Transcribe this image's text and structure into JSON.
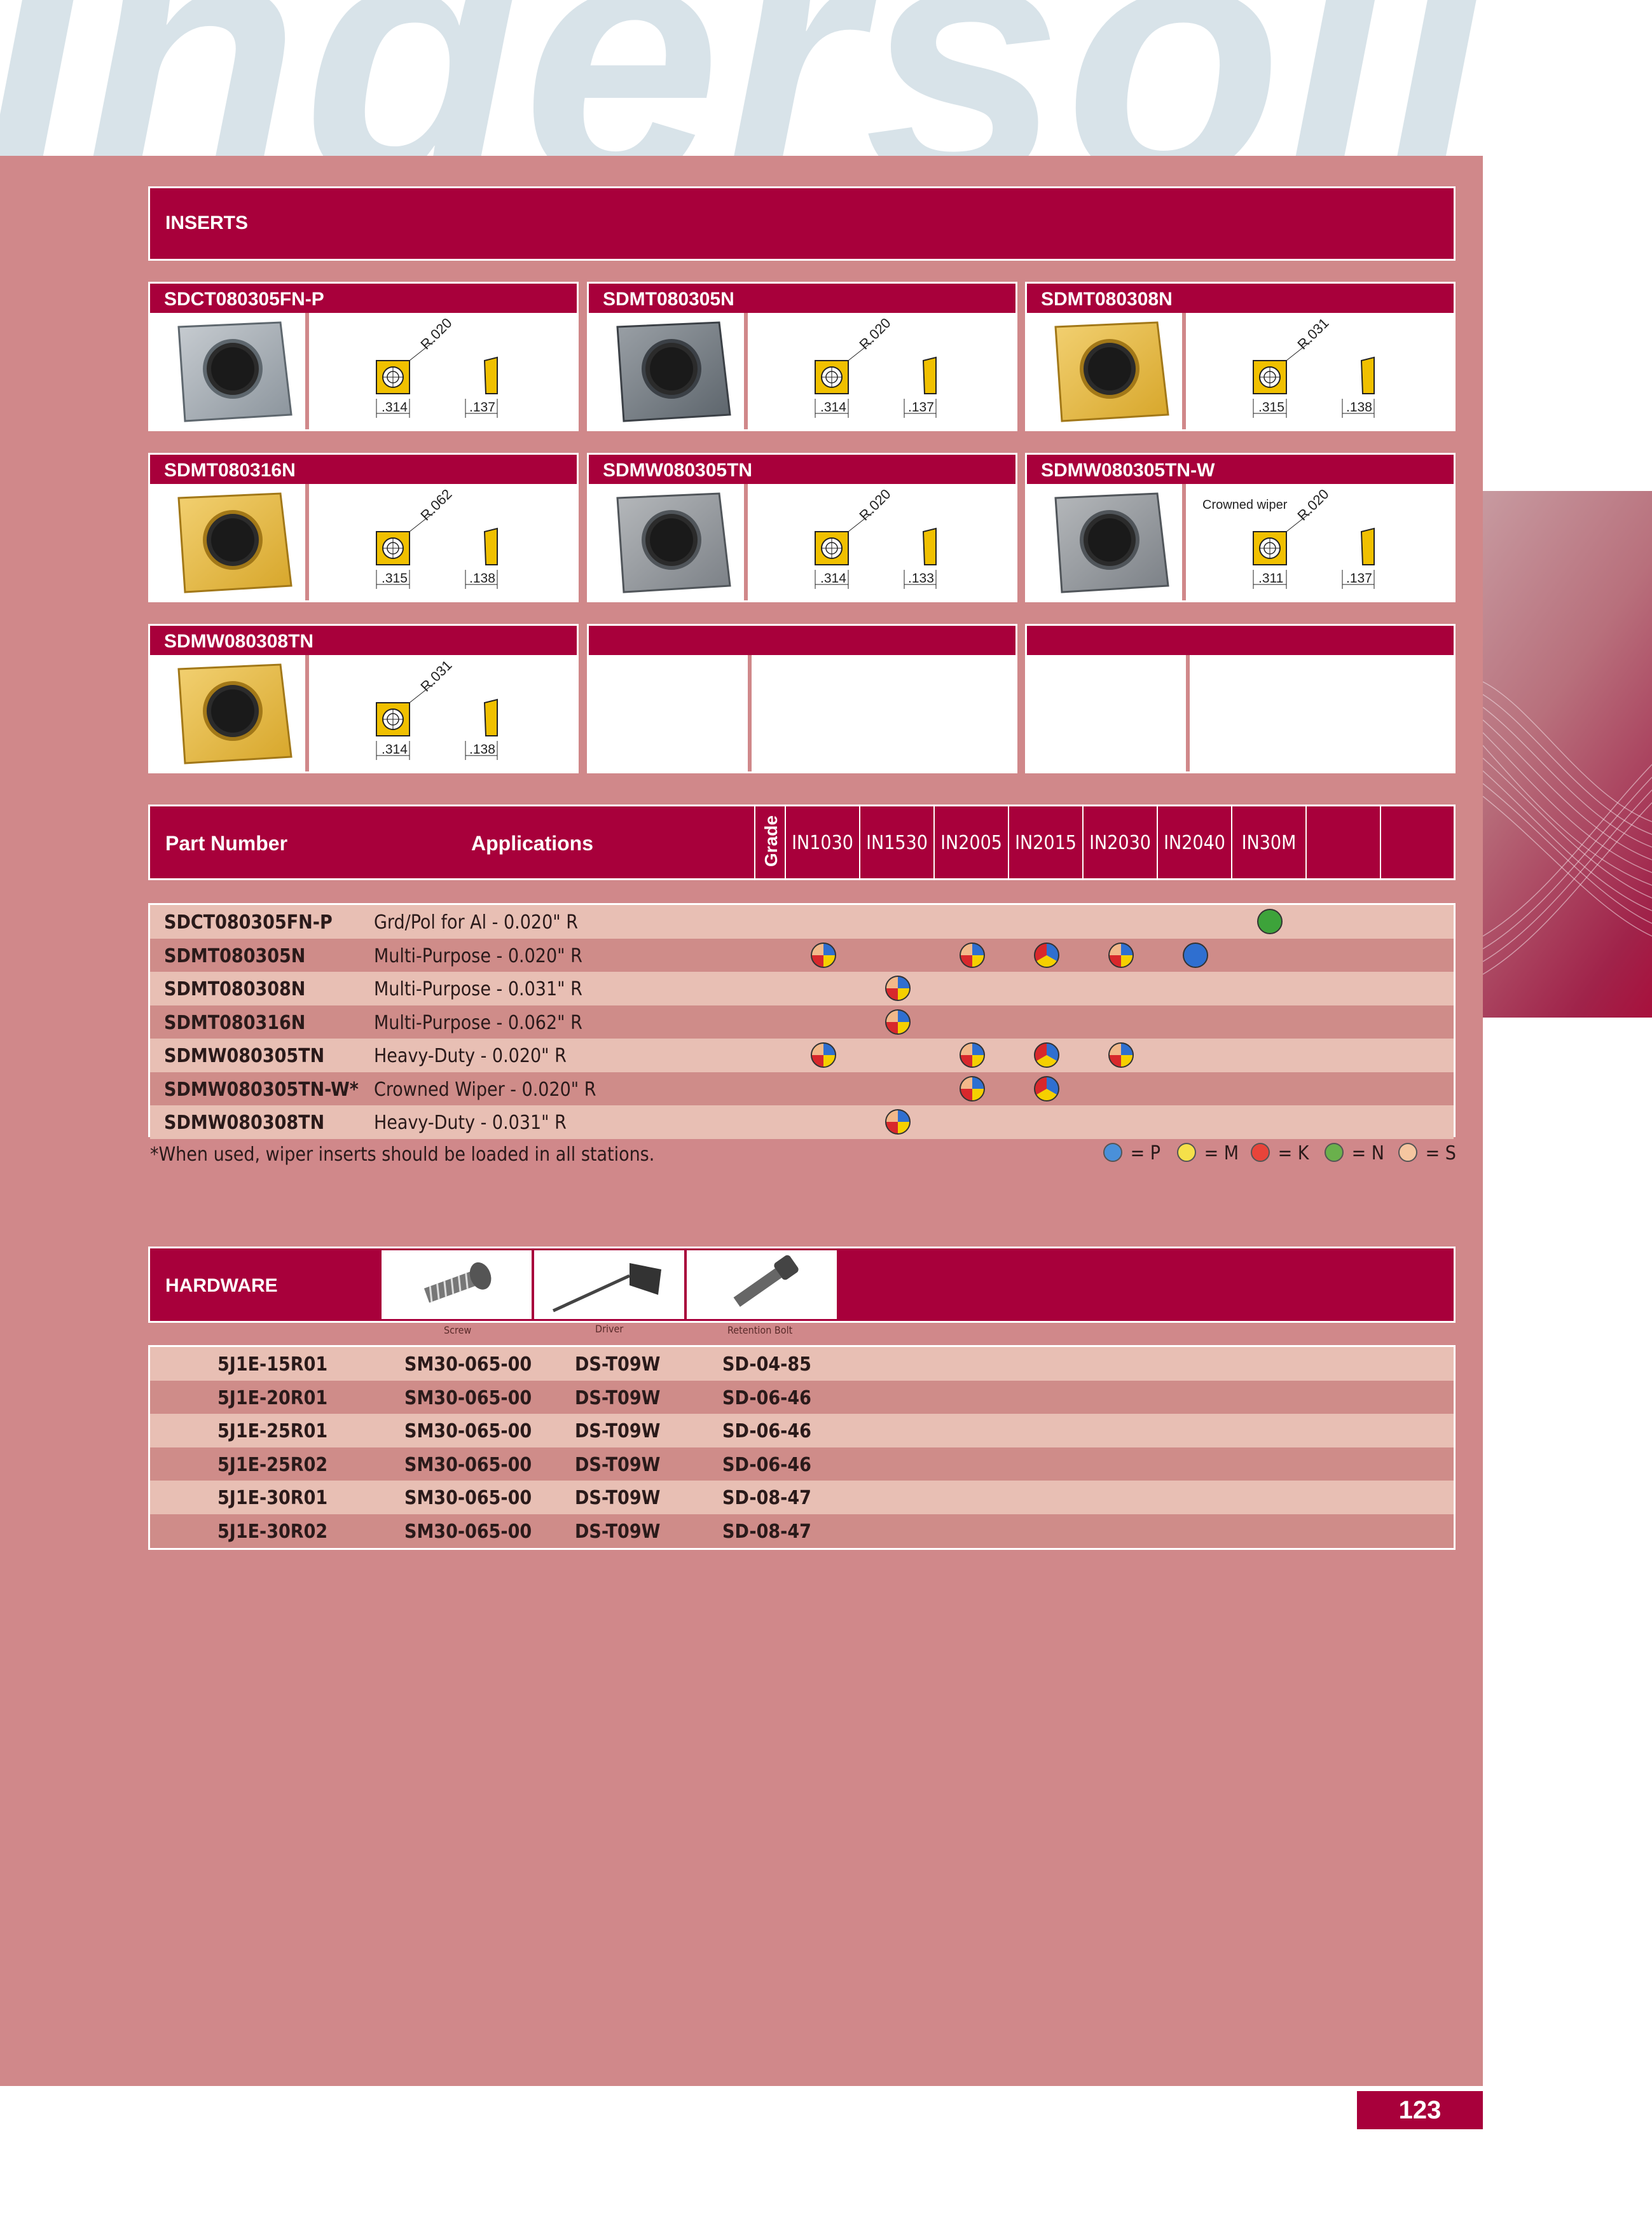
{
  "brand_watermark": "Ingersoll",
  "inserts_title": "INSERTS",
  "insert_cards": [
    {
      "name": "SDCT080305FN-P",
      "radius": "R.020",
      "width": ".314",
      "thick": ".137",
      "color": "silver"
    },
    {
      "name": "SDMT080305N",
      "radius": "R.020",
      "width": ".314",
      "thick": ".137",
      "color": "dark"
    },
    {
      "name": "SDMT080308N",
      "radius": "R.031",
      "width": ".315",
      "thick": ".138",
      "color": "gold"
    },
    {
      "name": "SDMT080316N",
      "radius": "R.062",
      "width": ".315",
      "thick": ".138",
      "color": "gold"
    },
    {
      "name": "SDMW080305TN",
      "radius": "R.020",
      "width": ".314",
      "thick": ".133",
      "color": "grey"
    },
    {
      "name": "SDMW080305TN-W",
      "radius": "R.020",
      "width": ".311",
      "thick": ".137",
      "color": "grey",
      "note": "Crowned wiper"
    },
    {
      "name": "SDMW080308TN",
      "radius": "R.031",
      "width": ".314",
      "thick": ".138",
      "color": "gold"
    }
  ],
  "grade_table": {
    "col_part": "Part Number",
    "col_app": "Applications",
    "col_grade": "Grade",
    "grades": [
      "IN1030",
      "IN1530",
      "IN2005",
      "IN2015",
      "IN2030",
      "IN2040",
      "IN30M",
      "",
      ""
    ],
    "rows": [
      {
        "part": "SDCT080305FN-P",
        "app": "Grd/Pol for Al - 0.020\" R",
        "marks": {
          "IN30M": "N"
        }
      },
      {
        "part": "SDMT080305N",
        "app": "Multi-Purpose - 0.020\" R",
        "marks": {
          "IN1030": "PMKS",
          "IN2005": "PMKS",
          "IN2015": "PMK",
          "IN2030": "PMKS",
          "IN2040": "P"
        }
      },
      {
        "part": "SDMT080308N",
        "app": "Multi-Purpose - 0.031\" R",
        "marks": {
          "IN1530": "PMKS"
        }
      },
      {
        "part": "SDMT080316N",
        "app": "Multi-Purpose - 0.062\" R",
        "marks": {
          "IN1530": "PMKS"
        }
      },
      {
        "part": "SDMW080305TN",
        "app": "Heavy-Duty - 0.020\" R",
        "marks": {
          "IN1030": "PMKS",
          "IN2005": "PMKS",
          "IN2015": "PMK",
          "IN2030": "PMKS"
        }
      },
      {
        "part": "SDMW080305TN-W*",
        "app": "Crowned Wiper - 0.020\" R",
        "marks": {
          "IN2005": "PMKS",
          "IN2015": "PMK"
        }
      },
      {
        "part": "SDMW080308TN",
        "app": "Heavy-Duty - 0.031\" R",
        "marks": {
          "IN1530": "PMKS"
        }
      }
    ],
    "footnote": "*When used, wiper inserts should be loaded in all stations.",
    "legend": [
      {
        "key": "= P",
        "color": "#4a90d9"
      },
      {
        "key": "= M",
        "color": "#f5e04a"
      },
      {
        "key": "= K",
        "color": "#e8443a"
      },
      {
        "key": "= N",
        "color": "#6ab04c"
      },
      {
        "key": "= S",
        "color": "#f5c6a0"
      }
    ]
  },
  "hardware": {
    "title": "HARDWARE",
    "captions": [
      "Screw",
      "Driver",
      "Retention Bolt"
    ],
    "rows": [
      [
        "5J1E-15R01",
        "SM30-065-00",
        "DS-T09W",
        "SD-04-85"
      ],
      [
        "5J1E-20R01",
        "SM30-065-00",
        "DS-T09W",
        "SD-06-46"
      ],
      [
        "5J1E-25R01",
        "SM30-065-00",
        "DS-T09W",
        "SD-06-46"
      ],
      [
        "5J1E-25R02",
        "SM30-065-00",
        "DS-T09W",
        "SD-06-46"
      ],
      [
        "5J1E-30R01",
        "SM30-065-00",
        "DS-T09W",
        "SD-08-47"
      ],
      [
        "5J1E-30R02",
        "SM30-065-00",
        "DS-T09W",
        "SD-08-47"
      ]
    ]
  },
  "page_number": "123",
  "colors": {
    "accent": "#a8003b",
    "panel": "#d0888a",
    "row_light": "#e8bfb4",
    "row_dark": "#cf8c89"
  }
}
